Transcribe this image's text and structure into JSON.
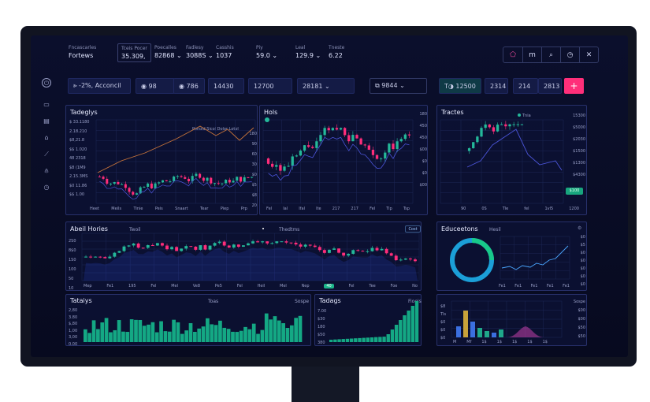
{
  "header": {
    "brand": {
      "line1": "Fncascarles",
      "line2": "Fortews"
    },
    "tickers": [
      {
        "label": "Tceis Pocer",
        "value": "35.309,"
      },
      {
        "label": "Poecalles",
        "value": "82868 ⌄"
      },
      {
        "label": "Fadlesy",
        "value": "3088S ⌄"
      },
      {
        "label": "Casshis",
        "value": "1037"
      },
      {
        "label": "Piy",
        "value": "59.0 ⌄"
      },
      {
        "label": "Leal",
        "value": "129.9 ⌄"
      },
      {
        "label": "Tneste",
        "value": "6.22"
      }
    ],
    "window_controls": [
      "⬠",
      "m",
      "⌕",
      "◷",
      "✕"
    ]
  },
  "nav_icons": [
    "power-icon",
    "chart-icon",
    "document-icon",
    "lock-icon",
    "trending-icon",
    "filter-icon",
    "clock-icon"
  ],
  "toolbar": {
    "chips": [
      "⪢ -2%, Acconcil",
      "◉ 98",
      "◉ 786",
      "14430",
      "12700",
      "28181 ⌄"
    ],
    "selector": "⧉ 9844 ⌄",
    "right_chips": [
      "T◑ 12500",
      "2314",
      "214",
      "2813"
    ],
    "plus_label": "+"
  },
  "panels": {
    "p1": {
      "title": "Tadeglys",
      "legend": "Ponoid Sicol Dolor Lotol",
      "y_labels": [
        "$ 33.1180",
        "2.18.210",
        "$8,21.8",
        "$$ 1.020",
        "48 2318",
        "$8 (1M9",
        "2.15.3MS",
        "$0 11.86",
        "$$ 1.00"
      ],
      "x_labels": [
        "Heet",
        "Meils",
        "Tinie",
        "Peis",
        "Snaart",
        "Tear",
        "Piep",
        "Prp"
      ]
    },
    "p2": {
      "title": "Hols",
      "y_labels": [
        "180",
        "90",
        "60",
        "30",
        "$0",
        "$5",
        "$8",
        "20"
      ],
      "x_labels": [
        "Fel",
        "Ial",
        "Ifal",
        "Ite",
        "217",
        "217",
        "Fel",
        "Tip",
        "Tsp"
      ],
      "right_labels": [
        "180",
        "450",
        "450",
        "$00",
        "$0",
        "$0",
        "$00"
      ]
    },
    "p3": {
      "title": "Tractes",
      "legend": "Tnia",
      "right_labels": [
        "15300",
        "$5000",
        "$2030",
        "$1500",
        "$1300",
        "$4300",
        "$0100"
      ],
      "badge": "$100",
      "x_labels": [
        "90",
        "0S",
        "Tle",
        "fel",
        "1vl5",
        "1200"
      ]
    },
    "p4": {
      "title": "Abeil Hories",
      "tag": "Twoil",
      "center": "Thedtms",
      "badge": "Cost",
      "y_labels": [
        "2S0",
        "8$0",
        "1S0",
        "100",
        "50",
        "10"
      ],
      "x_labels": [
        "Mep",
        "Fe1",
        "195",
        "Fel",
        "Mel",
        "Ve8",
        "Pe5",
        "Fel",
        "Heil",
        "Mel",
        "Nep",
        "Fel",
        "Tee",
        "Foe",
        "No"
      ],
      "highlight": "40"
    },
    "p5": {
      "title": "Educeetons",
      "tag": "Hesil",
      "y_labels": [
        "$0",
        "$5",
        "$0",
        "$0",
        "$0",
        "$0",
        "$0"
      ],
      "x_labels": [
        "Fe1",
        "Fe1",
        "Fe1",
        "Fe1",
        "Fe1"
      ]
    },
    "p6": {
      "title": "Tataiys",
      "center": "Toas",
      "right": "Sospe",
      "y_labels": [
        "2,80",
        "3.80",
        "$,80",
        "1,00",
        "3,00",
        "0.00"
      ]
    },
    "p7": {
      "title": "Tadags",
      "right": "Fioeis",
      "y_labels": [
        "7.00",
        "$30",
        "180",
        "$50",
        "380"
      ]
    },
    "p8": {
      "y_labels": [
        "$8",
        "Tls",
        "$0",
        "$0",
        "$0"
      ],
      "right": [
        "Sospe",
        "$00",
        "$00",
        "$50",
        "$50"
      ],
      "x_labels": [
        "M",
        "Mf",
        "1$",
        "1$",
        "1$",
        "1$",
        "1$"
      ]
    }
  },
  "colors": {
    "up": "#24b89a",
    "down": "#ff2d7a",
    "accent": "#ff2f7a",
    "line_orange": "#c8743a",
    "line_blue": "#4b54d8",
    "line_green": "#3ee27a",
    "bars": "#14a884"
  }
}
